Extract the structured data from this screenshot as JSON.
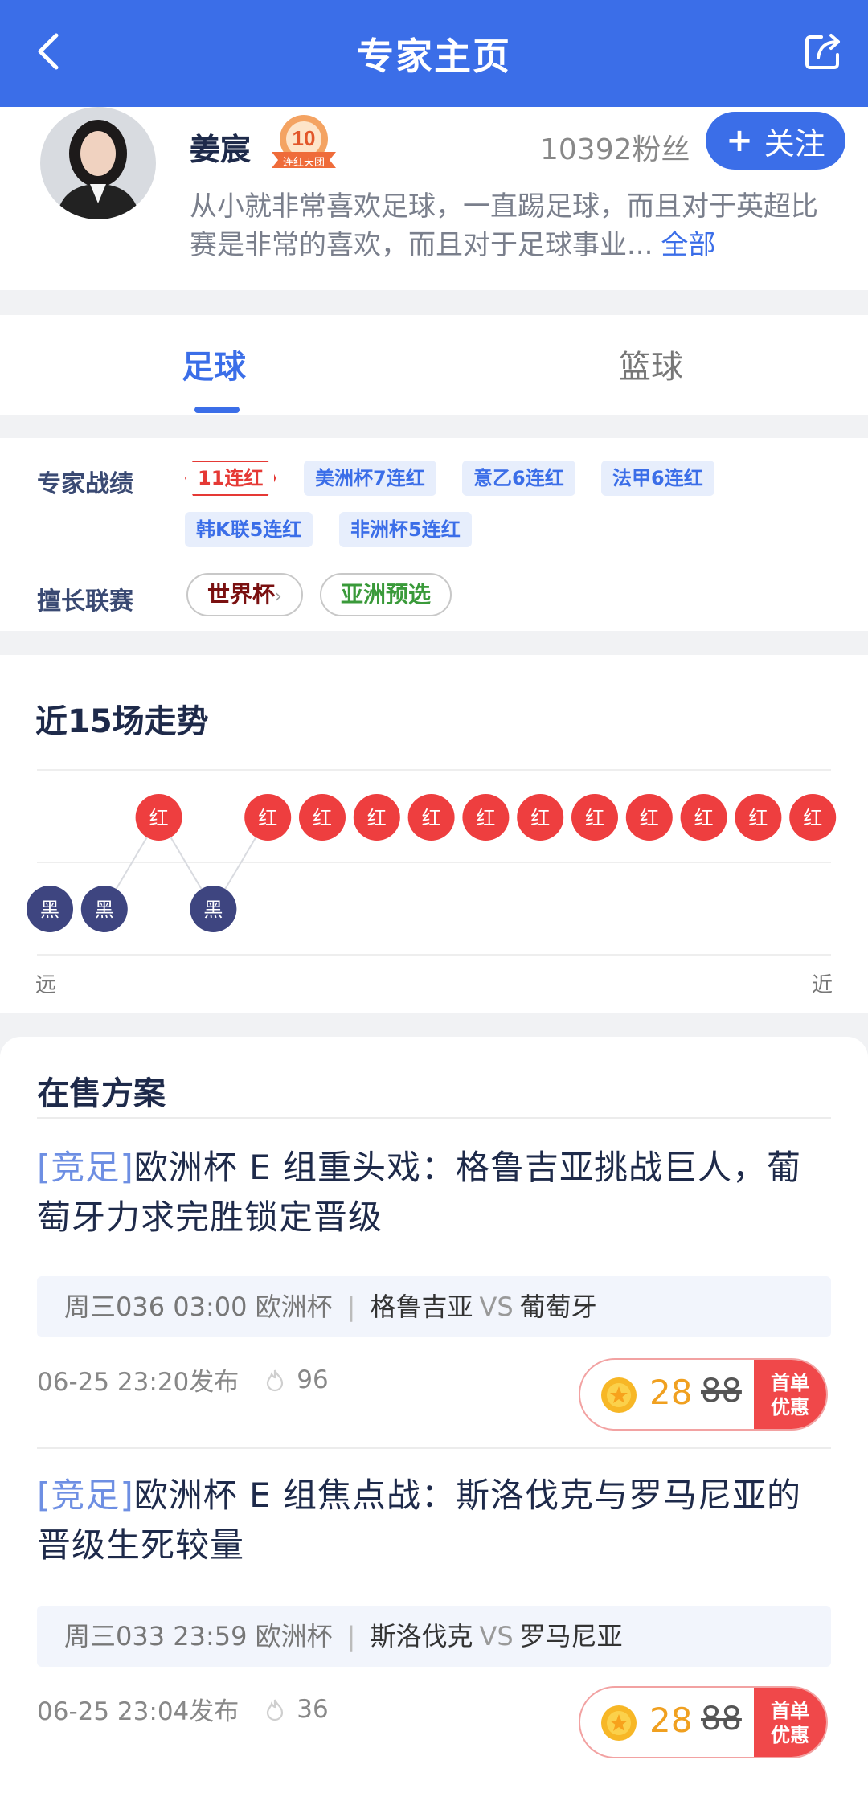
{
  "header": {
    "title": "专家主页"
  },
  "profile": {
    "name": "姜宸",
    "badge_number": "10",
    "badge_text": "连红天团",
    "fans": "10392粉丝",
    "follow_label": "关注",
    "bio": "从小就非常喜欢足球，一直踢足球，而且对于英超比赛是非常的喜欢，而且对于足球事业...",
    "bio_more": "全部"
  },
  "tabs": [
    {
      "label": "足球",
      "active": true
    },
    {
      "label": "篮球",
      "active": false
    }
  ],
  "record": {
    "label": "专家战绩",
    "chips": [
      "11连红",
      "美洲杯7连红",
      "意乙6连红",
      "法甲6连红",
      "韩K联5连红",
      "非洲杯5连红"
    ],
    "leagues_label": "擅长联赛",
    "leagues": [
      "世界杯",
      "亚洲预选"
    ]
  },
  "trend": {
    "title": "近15场走势",
    "results": [
      "黑",
      "黑",
      "红",
      "黑",
      "红",
      "红",
      "红",
      "红",
      "红",
      "红",
      "红",
      "红",
      "红",
      "红",
      "红"
    ],
    "red_label": "红",
    "black_label": "黑",
    "far_label": "远",
    "near_label": "近"
  },
  "sale": {
    "title": "在售方案",
    "items": [
      {
        "tag": "[竞足]",
        "title": "欧洲杯 E 组重头戏：格鲁吉亚挑战巨人，葡萄牙力求完胜锁定晋级",
        "match_info": "周三036 03:00 欧洲杯",
        "home": "格鲁吉亚",
        "vs": "VS",
        "away": "葡萄牙",
        "published": "06-25 23:20发布",
        "views": "96",
        "price": "28",
        "old_price": "88",
        "promo": "首单优惠"
      },
      {
        "tag": "[竞足]",
        "title": "欧洲杯 E 组焦点战：斯洛伐克与罗马尼亚的晋级生死较量",
        "match_info": "周三033 23:59 欧洲杯",
        "home": "斯洛伐克",
        "vs": "VS",
        "away": "罗马尼亚",
        "published": "06-25 23:04发布",
        "views": "36",
        "price": "28",
        "old_price": "88",
        "promo": "首单优惠"
      }
    ]
  },
  "colors": {
    "brand": "#3b6ee8",
    "red": "#ee3e3f",
    "black": "#3e4580",
    "gold": "#f0a020"
  }
}
